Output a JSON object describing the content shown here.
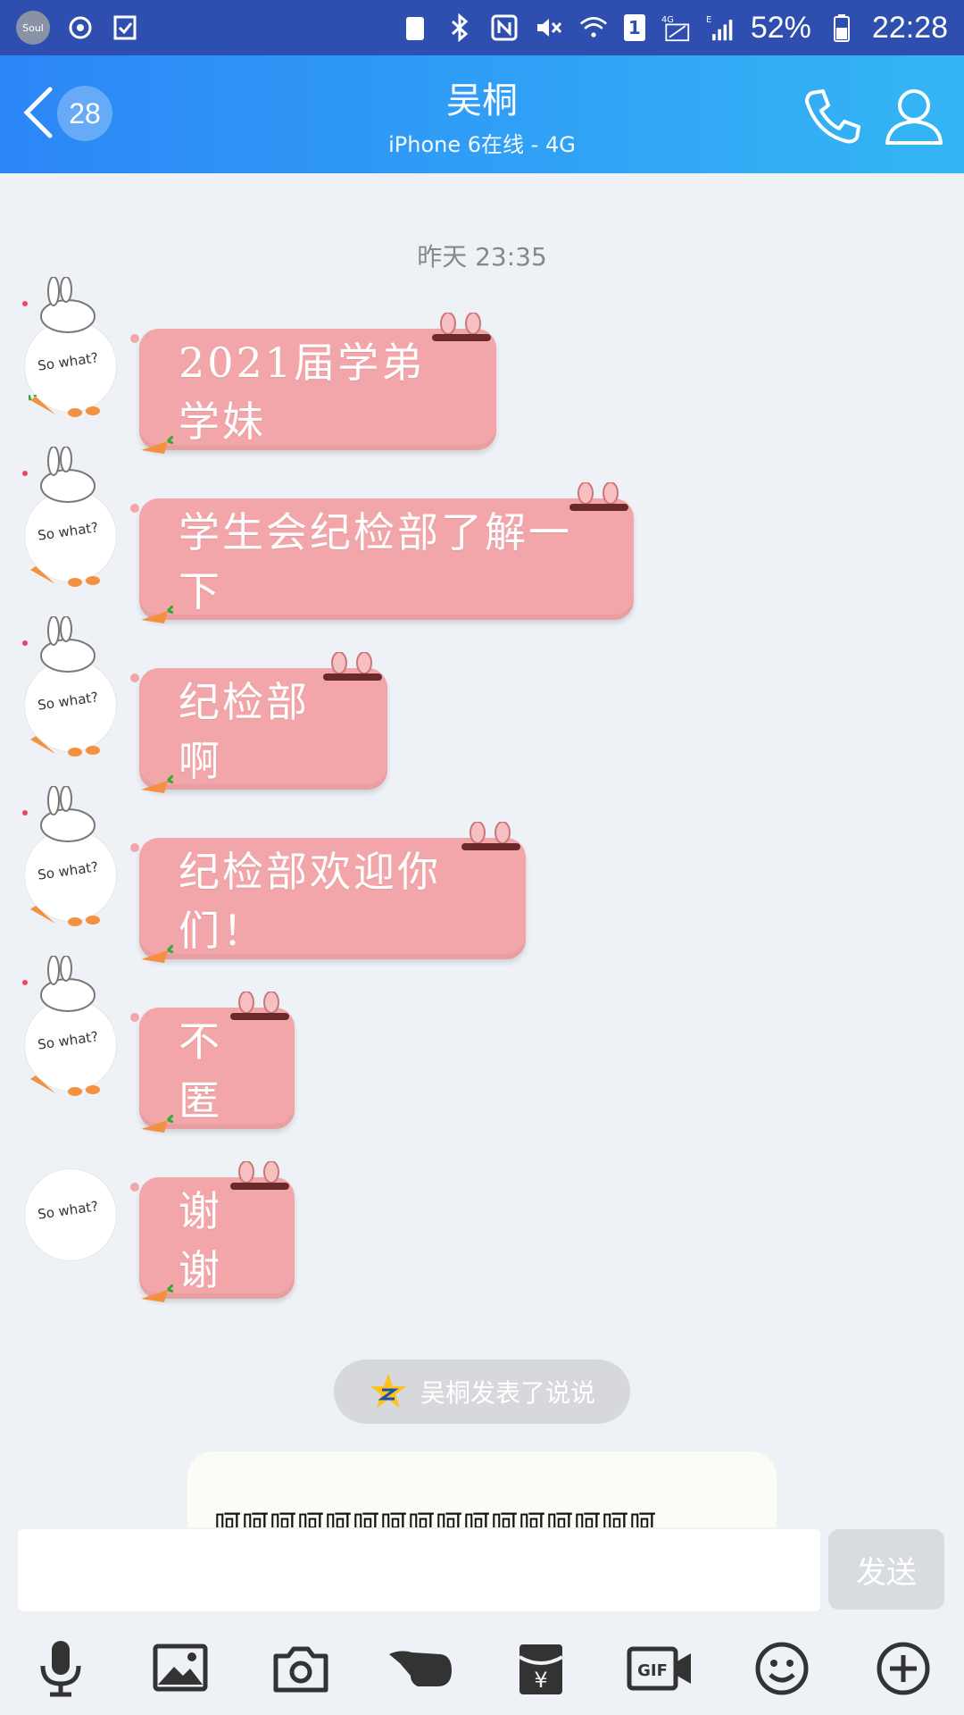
{
  "status_bar": {
    "app_badge": "Soul",
    "net_4g": "4G",
    "net_e": "E",
    "sim_badge": "1",
    "battery": "52%",
    "time": "22:28"
  },
  "header": {
    "unread_count": "28",
    "contact_name": "吴桐",
    "status": "iPhone 6在线 - 4G"
  },
  "chat": {
    "timestamp": "昨天 23:35",
    "avatar_text": "So what?",
    "messages": [
      {
        "text": "2021届学弟学妹"
      },
      {
        "text": "学生会纪检部了解一下"
      },
      {
        "text": "纪检部啊"
      },
      {
        "text": "纪检部欢迎你们！"
      },
      {
        "text": "不匿"
      },
      {
        "text": "谢谢"
      }
    ],
    "feed_notice": "吴桐发表了说说",
    "feed_preview": "呵呵呵呵呵呵呵呵呵呵呵呵呵呵呵呵"
  },
  "composer": {
    "input_value": "",
    "send_label": "发送"
  },
  "toolbar": {
    "icons": [
      "microphone-icon",
      "image-icon",
      "camera-icon",
      "poke-icon",
      "red-packet-icon",
      "gif-icon",
      "emoji-icon",
      "plus-icon"
    ],
    "red_packet_symbol": "¥",
    "gif_label": "GIF"
  },
  "colors": {
    "header_start": "#2b86f6",
    "header_end": "#34b6f5",
    "bubble": "#f2a6a9",
    "background": "#eef1f6"
  }
}
